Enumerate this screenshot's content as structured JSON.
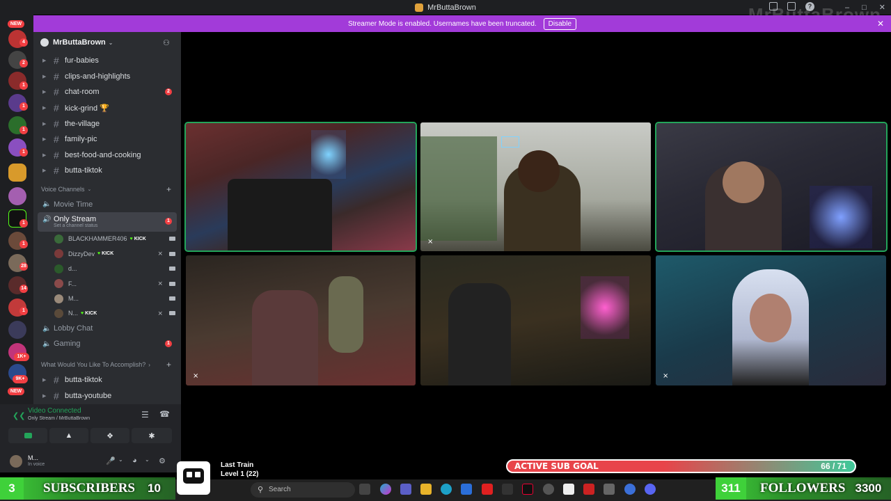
{
  "window": {
    "title": "MrButtaBrown",
    "watermark": "MrButtaBrown"
  },
  "banner": {
    "text": "Streamer Mode is enabled. Usernames have been truncated.",
    "button": "Disable"
  },
  "rail": {
    "new_badge": "NEW",
    "badges": [
      "4",
      "2",
      "1",
      "1",
      "1",
      "1",
      "1",
      "1",
      "1",
      "1",
      "28",
      "14",
      "1",
      "1K+",
      "9K+"
    ]
  },
  "server": {
    "name": "MrButtaBrown"
  },
  "text_channels": [
    {
      "name": "fur-babies",
      "badge": ""
    },
    {
      "name": "clips-and-highlights",
      "badge": ""
    },
    {
      "name": "chat-room",
      "badge": "2"
    },
    {
      "name": "kick-grind 🏆",
      "badge": ""
    },
    {
      "name": "the-village",
      "badge": ""
    },
    {
      "name": "family-pic",
      "badge": ""
    },
    {
      "name": "best-food-and-cooking",
      "badge": ""
    },
    {
      "name": "butta-tiktok",
      "badge": ""
    }
  ],
  "voice_category": "Voice Channels",
  "voice_channels": {
    "movie_time": "Movie Time",
    "only_stream": "Only Stream",
    "only_stream_sub": "Set a channel status",
    "only_stream_badge": "1",
    "lobby": "Lobby Chat",
    "gaming": "Gaming",
    "gaming_badge": "1"
  },
  "members": [
    {
      "name": "BLACKHAMMER406",
      "kick": "KICK"
    },
    {
      "name": "DizzyDev",
      "kick": "KICK"
    },
    {
      "name": "d...",
      "kick": ""
    },
    {
      "name": "F...",
      "kick": ""
    },
    {
      "name": "M...",
      "kick": ""
    },
    {
      "name": "N...",
      "kick": "KICK"
    }
  ],
  "bottom_category": "What Would You Like To Accomplish?",
  "bottom_channels": [
    "butta-tiktok",
    "butta-youtube"
  ],
  "voice_panel": {
    "status": "Video Connected",
    "location": "Only Stream / MrButtaBrown"
  },
  "user_panel": {
    "name": "M...",
    "status": "In voice"
  },
  "overlay": {
    "train_title": "Last Train",
    "train_level": "Level 1  (22)",
    "sub_goal_label": "ACTIVE SUB GOAL",
    "sub_goal_count": "66 / 71",
    "sub_goal_progress": 0.93,
    "subscribers_left": "3",
    "subscribers_label": "SUBSCRIBERS",
    "subscribers_right": "10",
    "followers_left": "311",
    "followers_label": "FOLLOWERS",
    "followers_right": "3300"
  },
  "taskbar": {
    "search_placeholder": "Search"
  },
  "colors": {
    "accent_purple": "#a23bd9",
    "speaking_green": "#23a55a",
    "badge_red": "#f23f43"
  }
}
